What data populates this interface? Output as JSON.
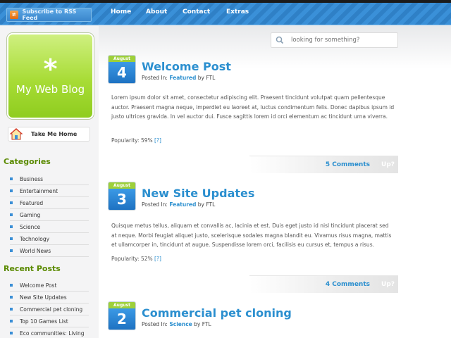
{
  "topbar": {
    "rss_label": "Subscribe to RSS Feed",
    "nav": [
      "Home",
      "About",
      "Contact",
      "Extras"
    ]
  },
  "sidebar": {
    "logo_symbol": "*",
    "logo_title": "My Web Blog",
    "home_button": "Take Me Home",
    "categories_heading": "Categories",
    "categories": [
      "Business",
      "Entertainment",
      "Featured",
      "Gaming",
      "Science",
      "Technology",
      "World News"
    ],
    "recent_heading": "Recent Posts",
    "recent_posts": [
      "Welcome Post",
      "New Site Updates",
      "Commercial pet cloning",
      "Top 10 Games List",
      "Eco communities: Living"
    ]
  },
  "search": {
    "placeholder": "looking for something?"
  },
  "posts": [
    {
      "month": "August",
      "day": "4",
      "title": "Welcome Post",
      "posted_in": "Posted In:",
      "category": "Featured",
      "by": "by FTL",
      "body": "Lorem ipsum dolor sit amet, consectetur adipiscing elit. Praesent tincidunt volutpat quam pellentesque auctor. Praesent magna neque, imperdiet eu laoreet at, luctus condimentum felis. Donec dapibus ipsum id justo ultrices gravida. In vel auctor dui. Fusce sagittis lorem id orci elementum ac tincidunt urna viverra.",
      "popularity_label": "Popularity:",
      "popularity": "59%",
      "popularity_help": "[?]",
      "comments": "5 Comments",
      "up": "Up?"
    },
    {
      "month": "August",
      "day": "3",
      "title": "New Site Updates",
      "posted_in": "Posted In:",
      "category": "Featured",
      "by": "by FTL",
      "body": "Quisque metus tellus, aliquam et convallis ac, lacinia et est. Duis eget justo id nisl tincidunt placerat sed at neque. Morbi feugiat aliquet justo, scelerisque sodales magna blandit eu. Vivamus risus magna, mattis et ullamcorper in, tincidunt at augue. Suspendisse lorem orci, facilisis eu cursus et, tempus a risus.",
      "popularity_label": "Popularity:",
      "popularity": "52%",
      "popularity_help": "[?]",
      "comments": "4 Comments",
      "up": "Up?"
    },
    {
      "month": "August",
      "day": "2",
      "title": "Commercial pet cloning",
      "posted_in": "Posted In:",
      "category": "Science",
      "by": "by FTL"
    }
  ],
  "colors": {
    "accent_blue": "#2b8fcf",
    "accent_green": "#9ed03a",
    "heading_green": "#5a8a00"
  },
  "icons": {
    "rss": "rss-icon",
    "home": "house-icon",
    "search": "search-icon",
    "bullet": "square-bullet"
  }
}
